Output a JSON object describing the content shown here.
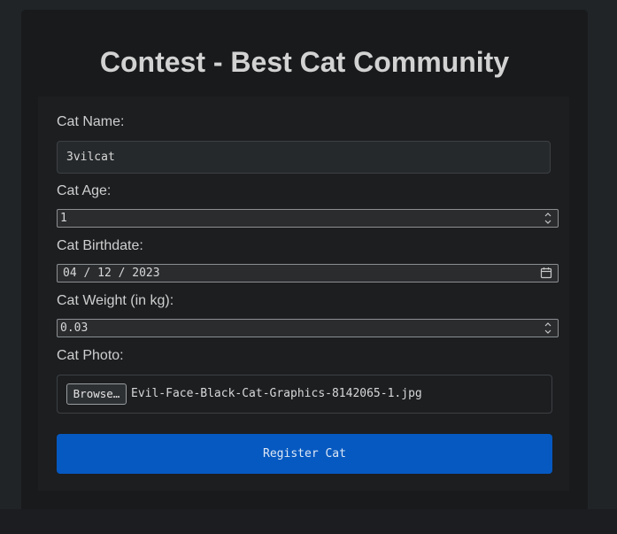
{
  "page": {
    "title": "Contest - Best Cat Community"
  },
  "form": {
    "name_label": "Cat Name:",
    "name_value": "3vilcat",
    "age_label": "Cat Age:",
    "age_value": "1",
    "birthdate_label": "Cat Birthdate:",
    "birthdate": {
      "month": "04",
      "day": "12",
      "year": "2023",
      "separator": "/"
    },
    "weight_label": "Cat Weight (in kg):",
    "weight_value": "0.03",
    "photo_label": "Cat Photo:",
    "browse_label": "Browse…",
    "photo_filename": "Evil-Face-Black-Cat-Graphics-8142065-1.jpg",
    "submit_label": "Register Cat"
  },
  "icons": {
    "age_spinner": "spinner-arrows-icon",
    "weight_spinner": "spinner-arrows-icon",
    "date_picker": "calendar-icon"
  },
  "colors": {
    "background": "#212427",
    "card": "#181a1c",
    "panel": "#1c1e20",
    "accent": "#0659c1",
    "text": "#cfcfcf"
  }
}
